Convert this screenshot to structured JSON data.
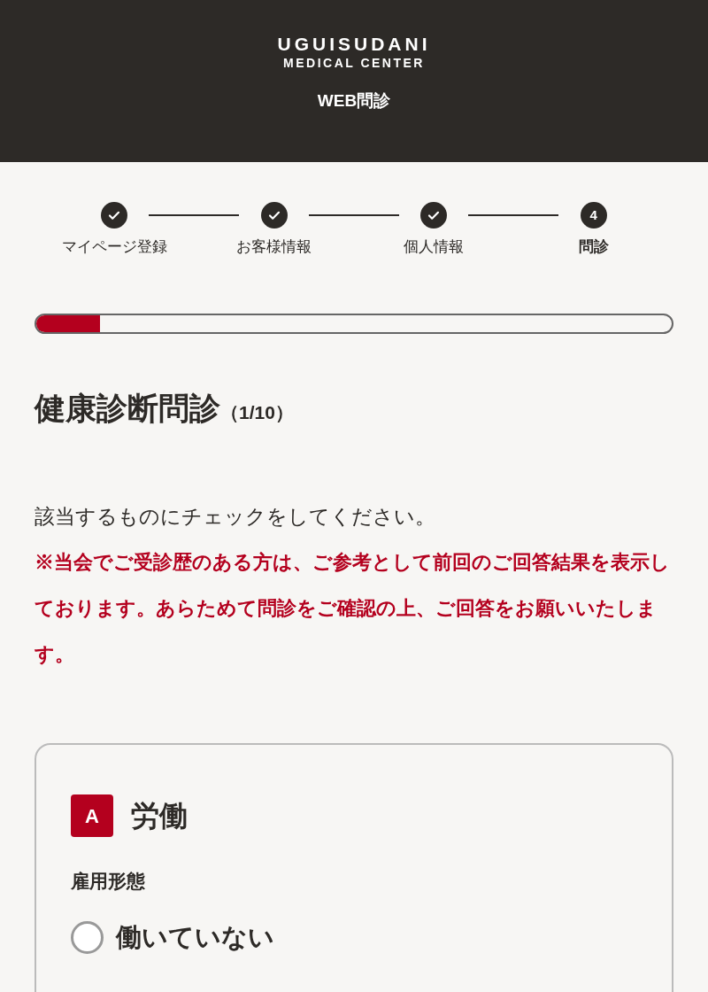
{
  "header": {
    "brand_line1": "UGUISUDANI",
    "brand_line2": "MEDICAL CENTER",
    "title": "WEB問診"
  },
  "steps": [
    {
      "label": "マイページ登録",
      "done": true,
      "selected": false
    },
    {
      "label": "お客様情報",
      "done": true,
      "selected": false
    },
    {
      "label": "個人情報",
      "done": true,
      "selected": false
    },
    {
      "label": "問診",
      "number": "4",
      "done": false,
      "selected": true
    }
  ],
  "progress": {
    "level": 0.1
  },
  "heading": {
    "title": "健康診断問診",
    "count": "（1/10）"
  },
  "instruction": "該当するものにチェックをしてください。",
  "notice": "※当会でご受診歴のある方は、ご参考として前回のご回答結果を表示しております。あらためて問診をご確認の上、ご回答をお願いいたします。",
  "section": {
    "badge": "A",
    "title": "労働",
    "question": "雇用形態",
    "options": [
      {
        "label": "働いていない",
        "selected": false
      }
    ]
  }
}
